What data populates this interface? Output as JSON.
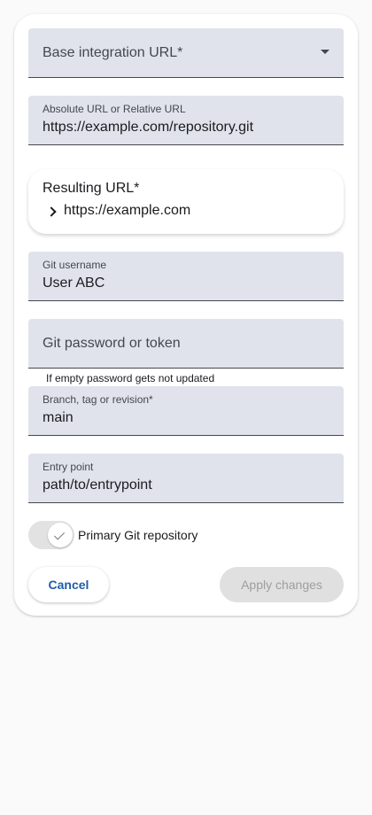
{
  "base_url": {
    "label": "Base integration URL*"
  },
  "url_field": {
    "label": "Absolute URL or Relative URL",
    "value": "https://example.com/repository.git"
  },
  "resulting_url": {
    "title": "Resulting URL*",
    "value": "https://example.com"
  },
  "git_username": {
    "label": "Git username",
    "value": "User ABC"
  },
  "git_password": {
    "label": "Git password or token",
    "hint": "If empty password gets not updated"
  },
  "branch": {
    "label": "Branch, tag or revision*",
    "value": "main"
  },
  "entry_point": {
    "label": "Entry point",
    "value": "path/to/entrypoint"
  },
  "primary_toggle": {
    "label": "Primary Git repository",
    "checked": true
  },
  "actions": {
    "cancel_label": "Cancel",
    "apply_label": "Apply changes"
  },
  "icons": {
    "dropdown": "chevron-down-icon",
    "result": "chevron-right-icon",
    "toggle": "check-icon"
  }
}
